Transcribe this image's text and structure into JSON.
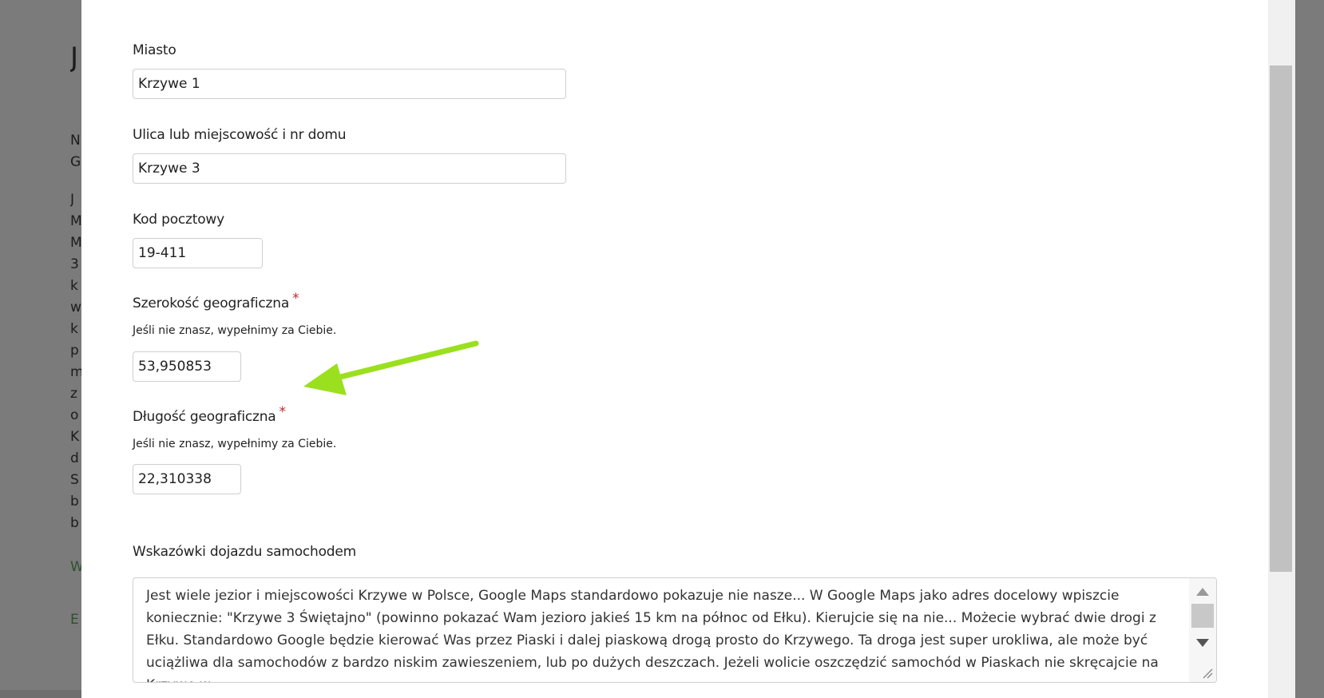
{
  "form": {
    "city": {
      "label": "Miasto",
      "value": "Krzywe 1"
    },
    "street": {
      "label": "Ulica lub miejscowość i nr domu",
      "value": "Krzywe 3"
    },
    "postal": {
      "label": "Kod pocztowy",
      "value": "19-411"
    },
    "latitude": {
      "label": "Szerokość geograficzna",
      "required_mark": "*",
      "hint": "Jeśli nie znasz, wypełnimy za Ciebie.",
      "value": "53,950853"
    },
    "longitude": {
      "label": "Długość geograficzna",
      "required_mark": "*",
      "hint": "Jeśli nie znasz, wypełnimy za Ciebie.",
      "value": "22,310338"
    },
    "directions": {
      "label": "Wskazówki dojazdu samochodem",
      "value": "Jest wiele jezior i miejscowości Krzywe w Polsce, Google Maps standardowo pokazuje nie nasze... W Google Maps jako adres docelowy wpiszcie koniecznie: \"Krzywe 3 Świętajno\" (powinno pokazać Wam jezioro jakieś 15 km na północ od Ełku). Kierujcie się na nie... Możecie wybrać dwie drogi z Ełku. Standardowo Google będzie kierować Was przez Piaski i dalej piaskową drogą prosto do Krzywego. Ta droga jest super urokliwa, ale może być uciążliwa dla samochodów z bardzo niskim zawieszeniem, lub po dużych deszczach. Jeżeli wolicie oszczędzić samochód w Piaskach nie skręcajcie na Krzywe w"
    }
  },
  "annotation": {
    "arrow_color": "#9be01e"
  },
  "background_fragments": [
    "J",
    "N",
    "G",
    "J",
    "M",
    "M",
    "3",
    "k",
    "w",
    "k",
    "p",
    "m",
    "z",
    "o",
    "K",
    "d",
    "S",
    "b",
    "b",
    "W",
    "E"
  ]
}
